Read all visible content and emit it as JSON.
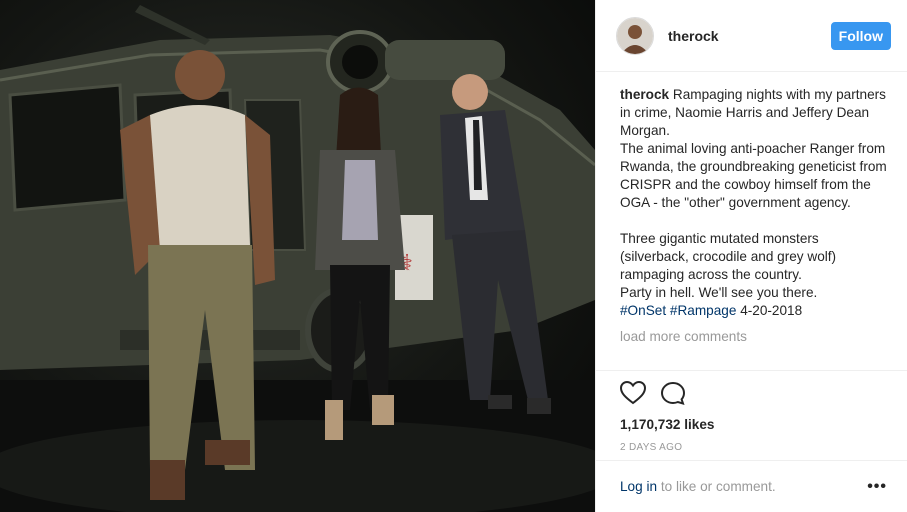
{
  "post": {
    "username": "therock",
    "follow_label": "Follow",
    "caption": {
      "username": "therock",
      "text": "Rampaging nights with my partners in crime, Naomie Harris and Jeffery Dean Morgan.\nThe animal loving anti-poacher Ranger from Rwanda, the groundbreaking geneticist from CRISPR and the cowboy himself from the OGA - the \"other\" government agency.\n\nThree gigantic mutated monsters (silverback, crocodile and grey wolf) rampaging across the country.\nParty in hell. We'll see you there.",
      "hashtag_1": "#OnSet",
      "hashtag_2": "#Rampage",
      "date_text": "4-20-2018"
    },
    "load_more": "load more comments",
    "likes": "1,170,732 likes",
    "timestamp": "2 DAYS AGO",
    "footer": {
      "login": "Log in",
      "rest": "to like or comment.",
      "more": "•••"
    },
    "icons": {
      "like": "heart-icon",
      "comment": "comment-icon",
      "options": "more-options-icon"
    },
    "colors": {
      "follow_button": "#3897f0",
      "hashtag": "#003569",
      "muted_text": "#999999"
    }
  }
}
